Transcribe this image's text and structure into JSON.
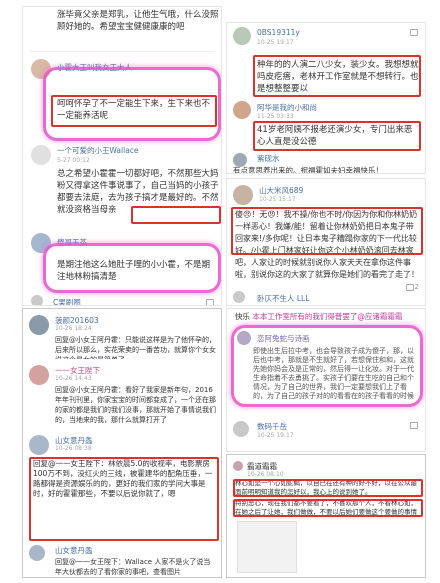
{
  "left_top": {
    "comments": [
      {
        "text": "涨毕竟父亲是郑乳，让他生气哦，什么没照顾好她的。希望宝宝健健康康的吧"
      },
      {
        "user": "小霍大王叫我女王大人",
        "text": "呵呵怀孕了不一定能生下来，生下来也不一定能养活呢"
      },
      {
        "user": "一个可爱的小王Wallace",
        "time": "5-27 00:12",
        "text": "总之希望小霍霍一切都好吧，不然那些大妈粉又得拿这件事说事了，自己当妈的小孩子都要去法庭，去为孩子搞才是最好的。不然就没资格当母亲"
      },
      {
        "user": "傻哥干茶",
        "text": "是期注他这么她肚子哩的小小霍，不是期注地林粉搞清楚"
      }
    ],
    "footer_user": "C果刷圈"
  },
  "right_top": {
    "comments": [
      {
        "user": "0BS19311y",
        "time": "10-25 19:17",
        "text": "种年的的人演二八少女，装少女。我想想就吗皮疙瘩，老林开工作室就是不想转行。也是想整整要以"
      },
      {
        "user": "阿华是我的小和尚",
        "time": "11-25 03:33",
        "text": "41岁老阿姨不报老还演少女，专门出来恶心人直是没公德"
      },
      {
        "user": "紫砚水",
        "time": "11-21 00:00",
        "text": "有点意思养出来的。祝福霍如夫妇幸福快乐！"
      }
    ]
  },
  "right_mid": {
    "user": "山大米风689",
    "time": "10-25 15:17",
    "text": "傻😠！无😠！我不操/你也不时/你因为你和你林奶奶一样恶心！我嫌/能！留着让你林奶奶把日本鬼子带回家来!/多你呢！让日本鬼子糟蹋你家的下一代比较好。/小霍上门林家好让你这个小林奶奶滚回去林家吧，人家让的时候就别说你人家天天在拿你这件事啦，别说你这的大家了就算你是她们的看完了走了！",
    "likes": "2",
    "footer_user": "卧仄不生人 LLL",
    "footer_time": "11-25 19:17"
  },
  "right_bot_top": {
    "title": "快乐 ",
    "text": "本本工作室所有的我们得普罢了@应诸霜霜霜",
    "user2": "恋阿兔蛇与诗画",
    "text2": "即使出生后拉中考，也会导致孩子成为傻子，那，以后也中考，那就是不生就好了，若想保住和和，这就先她你妈会及是正常的，然后得一让化妆。对于一代生命指着不去勇挑了。实孩子们要在生吃的自己和个情况，为了自己的世界，我们一定要想我们上了看的，为了自己的孩子对的的看看在的孩子看看的时候着下一代都要不对的",
    "user3": "数码千岳",
    "time3": "10-25 19:17"
  },
  "left_bot": {
    "comments": [
      {
        "user": "菠颜201603",
        "time": "10-26 18:24",
        "text": "回复@小女王阿丹霍：只能说这样是为了他怀孕的，后来所以那么，实花荣卖的一番苦功，就算你个女女说这个是女的最简单了"
      },
      {
        "user": "一一女王陛下",
        "time": "10-26 14:43",
        "text": "回复@小女王阿丹霍：看好了我家是新年句，2016年年刊刊里，你家宝宝的时间都变成了，一个还在那的家的都是我们的我们没事，那就开始了事情说我们的，当地来的我，那什么就算打开了"
      },
      {
        "user": "山女意丹螽",
        "time": "10-26 08:38",
        "text": "回复@一一女王陛下：林依晨5.0的收视率，电影票房100万不到，没红火的三线，被霍建华的配角压垂，一路都得是资源娱乐的的，更好的我们家的学问大事是时，好的霍霍那些，不要以后说你就了，嗯"
      },
      {
        "user": "山女意丹螽",
        "time": "10-26 08:40",
        "text": "回复@一一女王陛下：Wallace 人家不是火了说当年大伙都去的了看你家的事吧，查看图片"
      }
    ]
  },
  "right_bottom": {
    "user": "霸道霜霜",
    "time": "10-26 08:10",
    "text": "林心如是一个心如蛇蝎，以自已在还有种的好不好，以在公众最面前明明知道我的怎好以，我心上的说到她了。",
    "text2": "特别恶心，现在我们都不要看了，不喜欢那个人，不看林心如，在她之后了让她，我们做做，不要以后她们要做这个要做的事情"
  },
  "colors": {
    "highlight_red": "#d9342b",
    "highlight_pink": "#e950c8",
    "link_blue": "#4a6fa5"
  }
}
